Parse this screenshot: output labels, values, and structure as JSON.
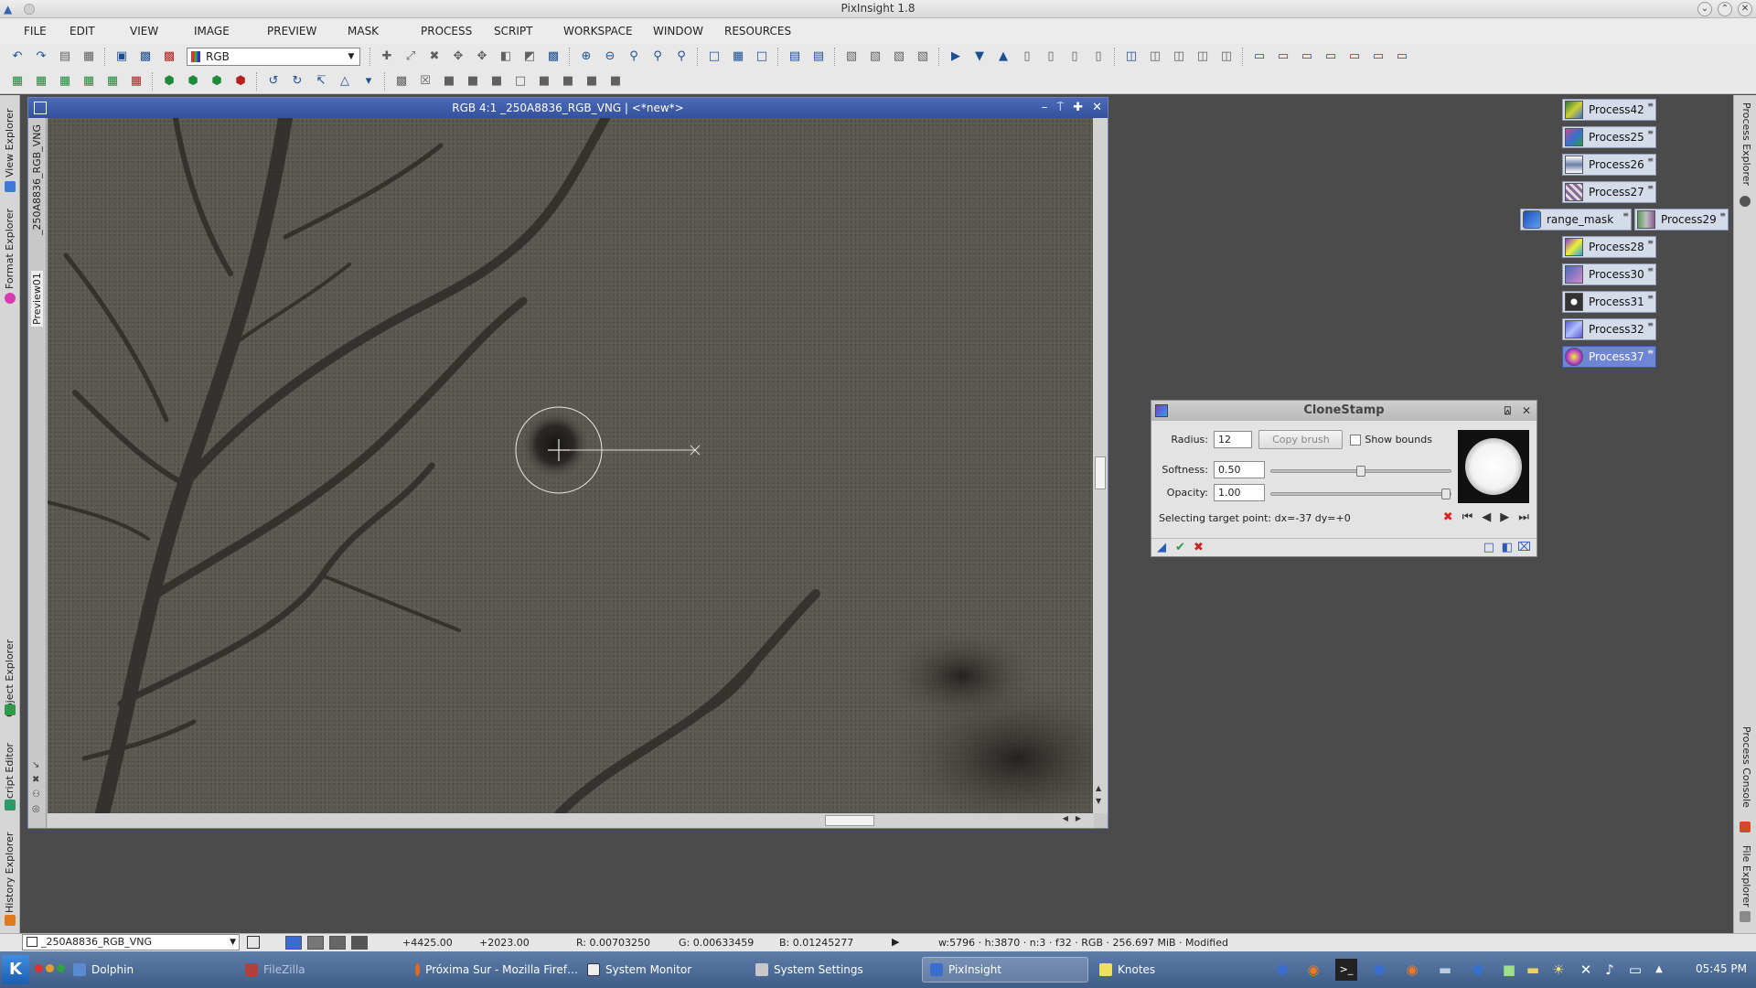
{
  "window": {
    "title": "PixInsight 1.8",
    "controls": [
      "⌄",
      "⌃",
      "✕"
    ]
  },
  "menu": [
    "FILE",
    "EDIT",
    "VIEW",
    "IMAGE",
    "PREVIEW",
    "MASK",
    "PROCESS",
    "SCRIPT",
    "WORKSPACE",
    "WINDOW",
    "RESOURCES"
  ],
  "toolbar": {
    "channel_select": "RGB"
  },
  "left_dock_tabs": [
    "View Explorer",
    "Format Explorer",
    "Object Explorer",
    "Script Editor",
    "History Explorer"
  ],
  "right_dock_tabs": [
    "Process Explorer",
    "Process Console",
    "File Explorer"
  ],
  "image_window": {
    "title": "RGB 4:1 _250A8836_RGB_VNG | <*new*>",
    "side_tabs": [
      "_250A8836_RGB_VNG",
      "Preview01"
    ],
    "controls": [
      "–",
      "⍑",
      "✚",
      "✕"
    ]
  },
  "process_icons": [
    {
      "label": "Process42",
      "selected": false,
      "color": "#2c7a3f"
    },
    {
      "label": "Process25",
      "selected": false,
      "color": "#c24c8a"
    },
    {
      "label": "Process26",
      "selected": false,
      "color": "#6a7fa8"
    },
    {
      "label": "Process27",
      "selected": false,
      "color": "#8a6a9a"
    },
    {
      "label": "range_mask",
      "selected": false,
      "color": "#3a6fd0"
    },
    {
      "label": "Process29",
      "selected": false,
      "color": "#5a9a5a"
    },
    {
      "label": "Process28",
      "selected": false,
      "color": "#8a3ad0"
    },
    {
      "label": "Process30",
      "selected": false,
      "color": "#4a68b8"
    },
    {
      "label": "Process31",
      "selected": false,
      "color": "#333333"
    },
    {
      "label": "Process32",
      "selected": false,
      "color": "#5a5ad0"
    },
    {
      "label": "Process37",
      "selected": true,
      "color": "#b43ad0"
    }
  ],
  "clonestamp": {
    "title": "CloneStamp",
    "radius_label": "Radius:",
    "radius_value": "12",
    "copy_brush_label": "Copy brush",
    "show_bounds_label": "Show bounds",
    "softness_label": "Softness:",
    "softness_value": "0.50",
    "opacity_label": "Opacity:",
    "opacity_value": "1.00",
    "status": "Selecting target point: dx=-37 dy=+0",
    "softness_level": 0.5,
    "opacity_level": 1.0
  },
  "statusbar": {
    "view_name": "_250A8836_RGB_VNG",
    "x": "+4425.00",
    "y": "+2023.00",
    "r": "R: 0.00703250",
    "g": "G: 0.00633459",
    "b": "B: 0.01245277",
    "info": "w:5796 · h:3870 · n:3 · f32 · RGB · 256.697 MiB · Modified"
  },
  "taskbar": {
    "items": [
      {
        "label": "Dolphin",
        "active": false,
        "dim": false
      },
      {
        "label": "FileZilla",
        "active": false,
        "dim": true
      },
      {
        "label": "Próxima Sur - Mozilla Firef…",
        "active": false,
        "dim": false
      },
      {
        "label": "System Monitor",
        "active": false,
        "dim": false
      },
      {
        "label": "System Settings",
        "active": false,
        "dim": false
      },
      {
        "label": "PixInsight",
        "active": true,
        "dim": false
      },
      {
        "label": "Knotes",
        "active": false,
        "dim": false
      }
    ],
    "clock": "05:45 PM"
  }
}
